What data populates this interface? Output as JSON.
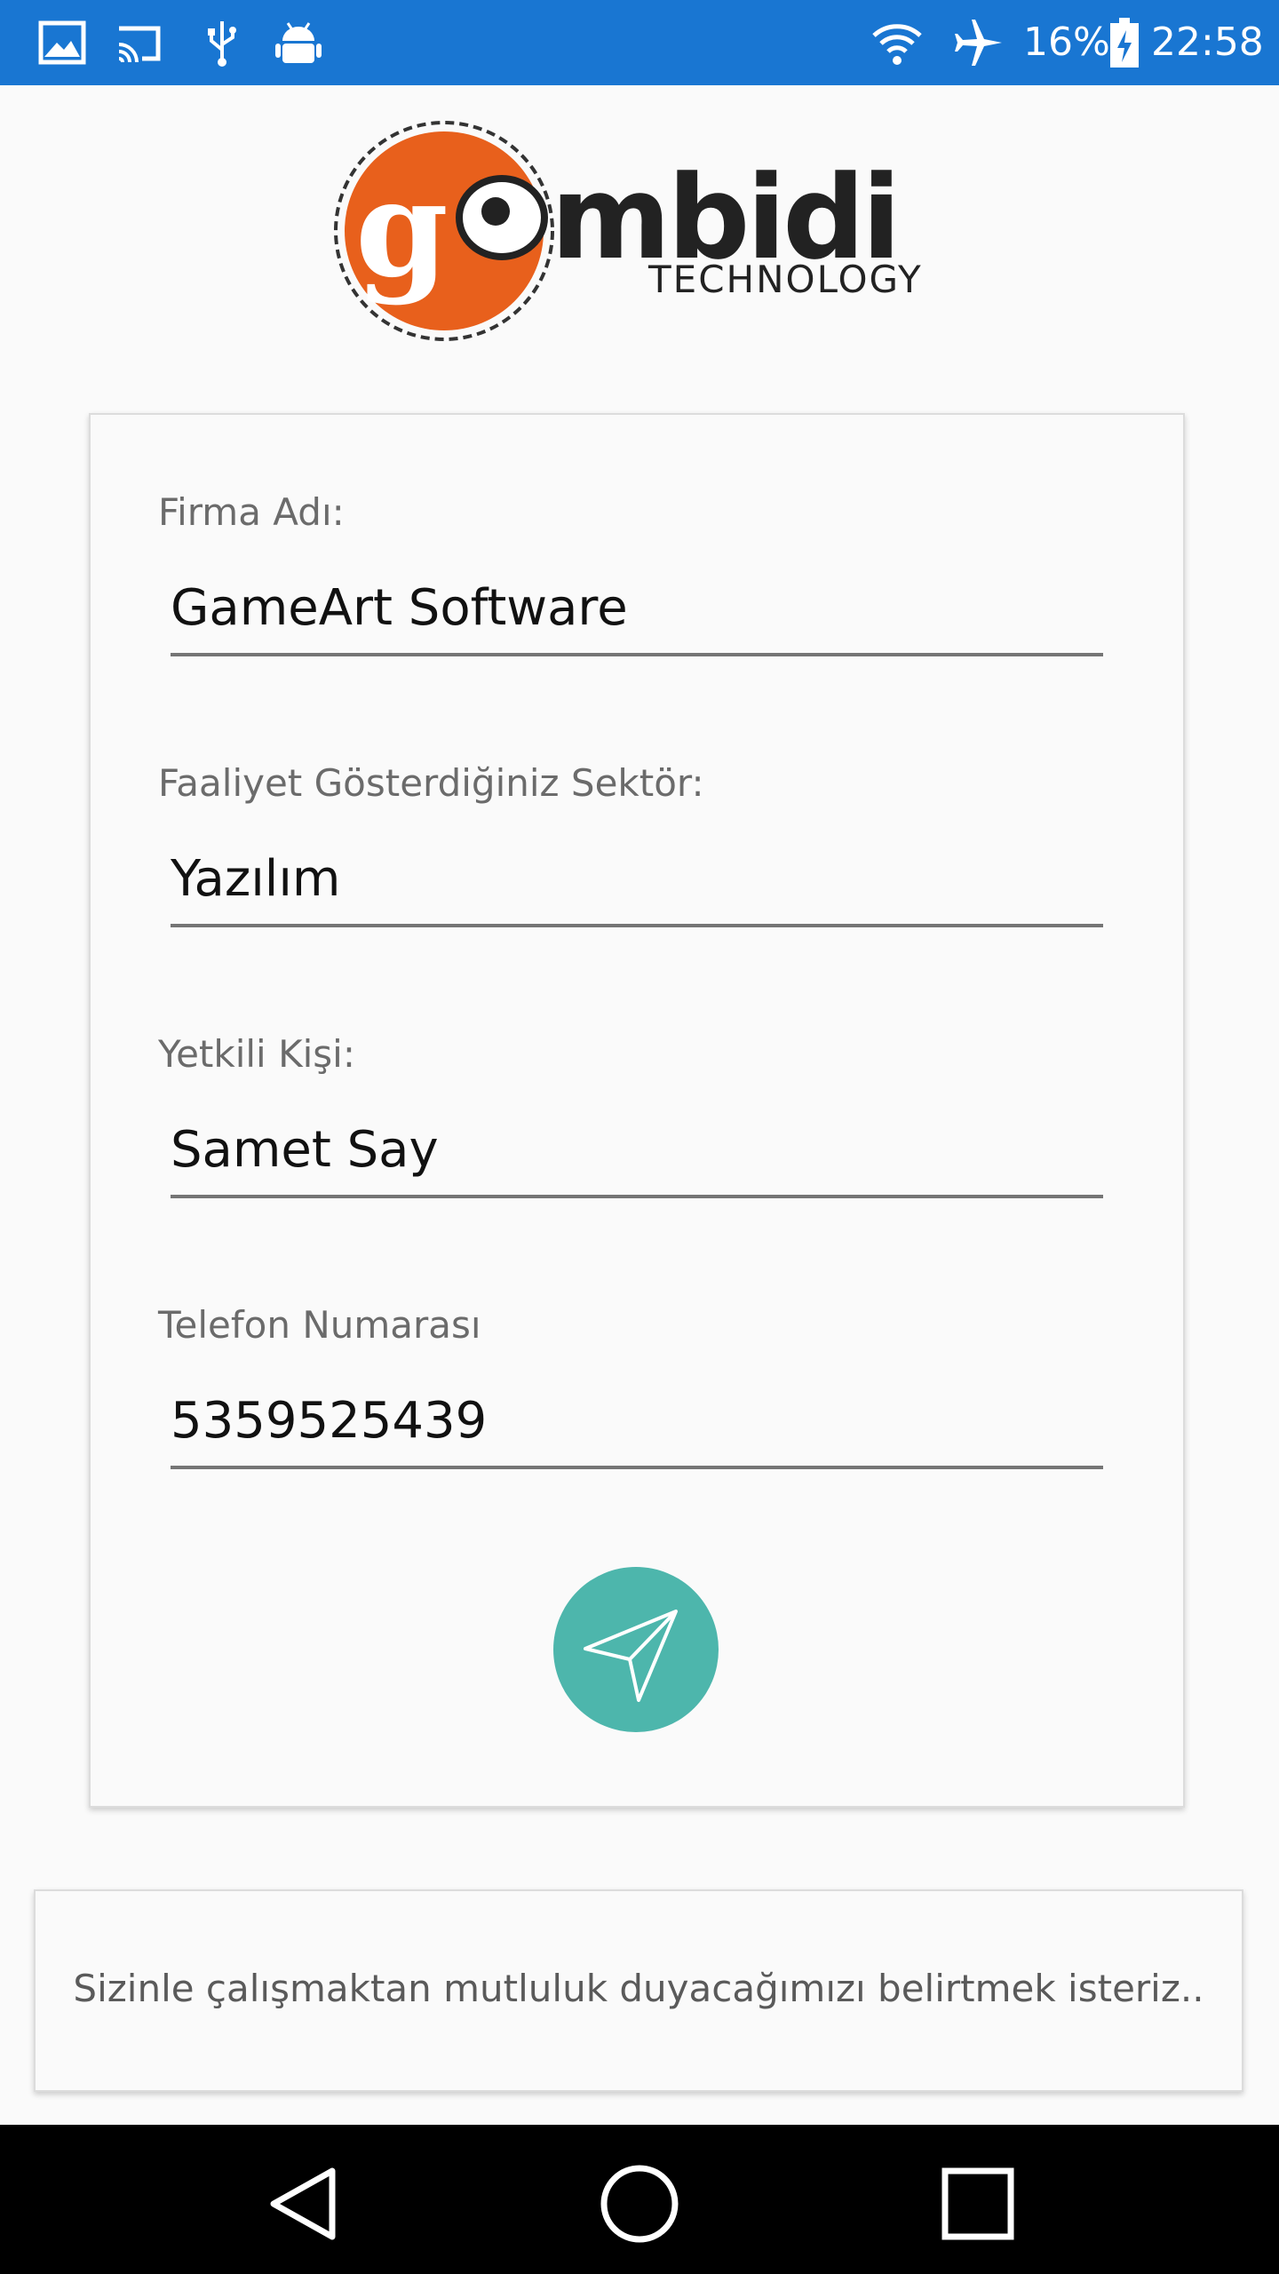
{
  "status_bar": {
    "battery_percent": "16%",
    "time": "22:58",
    "icons": [
      "gallery-icon",
      "cast-icon",
      "usb-icon",
      "android-debug-icon",
      "wifi-icon",
      "airplane-mode-icon",
      "battery-charging-icon"
    ]
  },
  "logo": {
    "word": "mbidi",
    "subtitle": "TECHNOLOGY",
    "brand_color": "#e8601c"
  },
  "form": {
    "fields": [
      {
        "label": "Firma Adı:",
        "value": "GameArt Software"
      },
      {
        "label": "Faaliyet Gösterdiğiniz Sektör:",
        "value": "Yazılım"
      },
      {
        "label": "Yetkili Kişi:",
        "value": "Samet Say"
      },
      {
        "label": "Telefon Numarası",
        "value": "5359525439"
      }
    ],
    "send_button": {
      "icon": "send-icon",
      "color": "#4db6ac"
    }
  },
  "message": {
    "text": "Sizinle çalışmaktan mutluluk duyacağımızı belirtmek isteriz.."
  },
  "nav_bar": {
    "buttons": [
      "back-icon",
      "home-icon",
      "recents-icon"
    ]
  },
  "colors": {
    "status_bar": "#1976d2",
    "background": "#fafafa",
    "accent": "#4db6ac"
  }
}
